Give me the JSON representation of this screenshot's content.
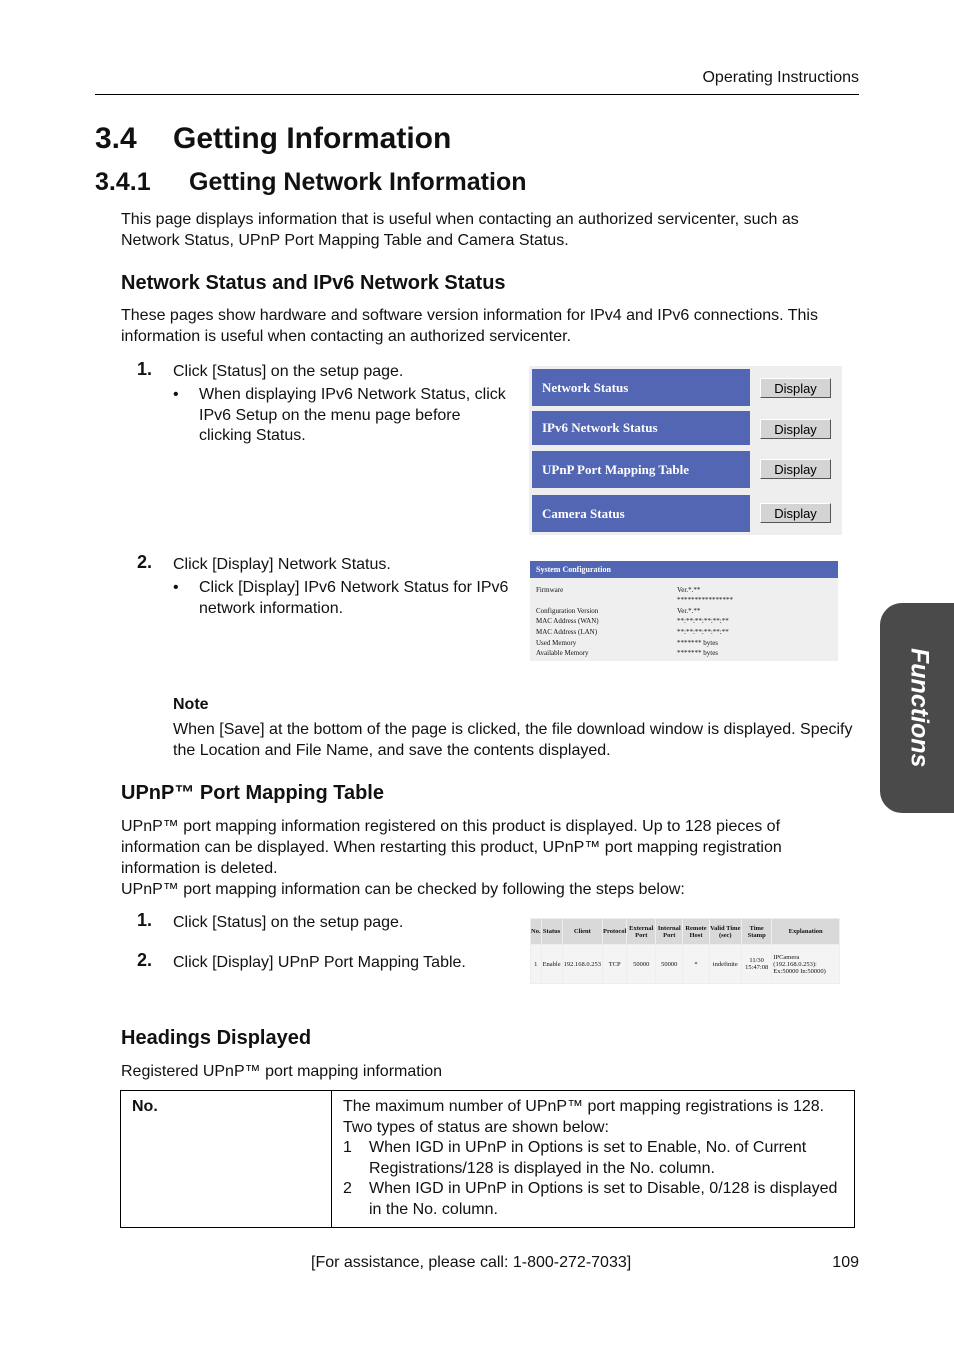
{
  "header": {
    "title": "Operating Instructions"
  },
  "section": {
    "number": "3.4",
    "title": "Getting Information"
  },
  "subsection": {
    "number": "3.4.1",
    "title": "Getting Network Information"
  },
  "intro": {
    "line1": "This page displays information that is useful when contacting an authorized servicenter, such as",
    "line2": "Network Status, UPnP Port Mapping Table and Camera Status."
  },
  "network_status": {
    "heading": "Network Status and IPv6 Network Status",
    "para_line1": "These pages show hardware and software version information for IPv4 and IPv6 connections. This",
    "para_line2": "information is useful when contacting an authorized servicenter.",
    "steps": [
      {
        "num": "1.",
        "text": "Click [Status] on the setup page.",
        "bullet": [
          "When displaying IPv6 Network Status, click",
          "IPv6 Setup on the menu page before",
          "clicking Status."
        ]
      },
      {
        "num": "2.",
        "text": "Click [Display] Network Status.",
        "bullet": [
          "Click [Display] IPv6 Network Status for IPv6",
          "network information."
        ]
      }
    ],
    "bullet_glyph": "•",
    "status_menu": {
      "rows": [
        {
          "label": "Network Status",
          "button": "Display"
        },
        {
          "label": "IPv6 Network Status",
          "button": "Display"
        },
        {
          "label": "UPnP Port Mapping Table",
          "button": "Display"
        },
        {
          "label": "Camera Status",
          "button": "Display"
        }
      ]
    },
    "system_configuration": {
      "title": "System Configuration",
      "rows": [
        {
          "key": "Firmware",
          "value": "Ver.*.**"
        },
        {
          "key": "",
          "value": "****************"
        },
        {
          "key": "Configuration Version",
          "value": "Ver.*.**"
        },
        {
          "key": "MAC Address (WAN)",
          "value": "**:**:**:**:**:**"
        },
        {
          "key": "MAC Address (LAN)",
          "value": "**:**:**:**:**:**"
        },
        {
          "key": "Used Memory",
          "value": "******* bytes"
        },
        {
          "key": "Available Memory",
          "value": "******* bytes"
        }
      ]
    },
    "note": {
      "title": "Note",
      "line1": "When [Save] at the bottom of the page is clicked, the file download window is displayed. Specify",
      "line2": "the Location and File Name, and save the contents displayed."
    }
  },
  "upnp": {
    "heading": "UPnP™ Port Mapping Table",
    "para_lines": [
      "UPnP™ port mapping information registered on this product is displayed. Up to 128 pieces of",
      "information can be displayed. When restarting this product, UPnP™ port mapping registration",
      "information is deleted.",
      "UPnP™ port mapping information can be checked by following the steps below:"
    ],
    "steps": [
      {
        "num": "1.",
        "text": "Click [Status] on the setup page."
      },
      {
        "num": "2.",
        "text": "Click [Display] UPnP Port Mapping Table."
      }
    ],
    "table": {
      "headers": [
        "No.",
        "Status",
        "Client",
        "Protocol",
        "External Port",
        "Internal Port",
        "Remote Host",
        "Valid Time (sec)",
        "Time Stamp",
        "Explanation"
      ],
      "row": [
        "1",
        "Enable",
        "192.168.0.253",
        "TCP",
        "50000",
        "50000",
        "*",
        "indefinite",
        "11/30 15:47:08",
        "IPCamera (192.168.0.253): Ex:50000 In:50000)"
      ]
    }
  },
  "headings_displayed": {
    "heading": "Headings Displayed",
    "caption": "Registered UPnP™ port mapping information",
    "rows": [
      {
        "name": "No.",
        "desc_line1": "The maximum number of UPnP™ port mapping registrations is 128.",
        "desc_line2": "Two types of status are shown below:",
        "items": [
          {
            "n": "1",
            "text": "When IGD in UPnP in Options is set to Enable, No. of Current Registrations/128 is displayed in the No. column."
          },
          {
            "n": "2",
            "text": "When IGD in UPnP in Options is set to Disable, 0/128 is displayed in the No. column."
          }
        ]
      }
    ]
  },
  "side_tab": {
    "label": "Functions"
  },
  "footer": {
    "assistance": "[For assistance, please call: 1-800-272-7033]",
    "page_number": "109"
  },
  "colors": {
    "menu_blue": "#5266b4",
    "side_tab": "#4a4a4a"
  }
}
